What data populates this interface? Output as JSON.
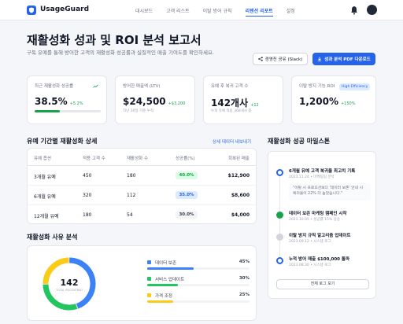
{
  "app": {
    "brand": "UsageGuard"
  },
  "nav": {
    "links": [
      "대시보드",
      "고객 리스트",
      "이탈 방어 규칙",
      "리텐션 리포트",
      "설정"
    ],
    "active_index": 3
  },
  "header": {
    "title": "재활성화 성과 및 ROI 분석 보고서",
    "subtitle": "구독 유예를 통해 방어한 고객의 재활성화 성공률과 실질적인 매출 기여도를 확인하세요.",
    "share_label": "경영진 공유 (Slack)",
    "pdf_label": "성과 분석 PDF 다운로드"
  },
  "kpis": [
    {
      "label": "최근 재활성화 성공률",
      "value": "38.5%",
      "delta": "+5.2%",
      "progress": 0.385
    },
    {
      "label": "방어한 매출액 (LTV)",
      "value": "$24,500",
      "delta": "+$3,200",
      "sub": "지난 30일 기준 누적"
    },
    {
      "label": "유예 후 복귀 고객 수",
      "value": "142개사",
      "delta": "+12",
      "sub": "누적 유예 적용 368개사 중"
    },
    {
      "label": "이탈 방지 기능 ROI",
      "value": "1,200%",
      "delta": "+150%",
      "badge": "High Efficiency"
    }
  ],
  "table": {
    "title": "유예 기간별 재활성화 상세",
    "link": "상세 데이터 내보내기",
    "headers": [
      "유예 옵션",
      "적용 고객 수",
      "재활성화 수",
      "성공률(%)",
      "회복된 매출"
    ],
    "rows": [
      {
        "option": "3개월 유예",
        "applied": "450",
        "reactivated": "180",
        "rate": "40.0%",
        "revenue": "$12,900"
      },
      {
        "option": "6개월 유예",
        "applied": "320",
        "reactivated": "112",
        "rate": "35.0%",
        "revenue": "$8,600"
      },
      {
        "option": "12개월 유예",
        "applied": "180",
        "reactivated": "54",
        "rate": "30.0%",
        "revenue": "$4,000"
      }
    ]
  },
  "reasons": {
    "title": "재활성화 사유 분석",
    "total": "142",
    "total_label": "TOTAL RECOVERED",
    "items": [
      {
        "label": "데이터 보존",
        "pct": "45%",
        "value": 45,
        "color": "#3b82f6"
      },
      {
        "label": "서비스 업데이트",
        "pct": "30%",
        "value": 30,
        "color": "#22c55e"
      },
      {
        "label": "가격 조정",
        "pct": "25%",
        "value": 25,
        "color": "#facc15"
      }
    ]
  },
  "milestones": {
    "title": "재활성화 성공 마일스톤",
    "items": [
      {
        "title": "6개월 유예 고객 복귀율 최고치 기록",
        "date": "2023.11.24 • 마케팅팀 분석"
      },
      {
        "title": "데이터 보존 마케팅 캠페인 시작",
        "date": "2023.10.05 • 성공률 15% 상승"
      },
      {
        "title": "이탈 방지 규칙 알고리즘 업데이트",
        "date": "2023.09.12 • 시스템 로그"
      },
      {
        "title": "누적 방어 매출 $100,000 돌파",
        "date": "2023.08.30 • 시스템 로그"
      }
    ],
    "quote": "\"이탈 시 프로모션보다 '데이터 보존' 안내 시 복귀율이 22% 더 높았습니다.\"",
    "button": "전체 로그 보기"
  },
  "colors": {
    "accent": "#2563eb",
    "success": "#16a34a"
  }
}
